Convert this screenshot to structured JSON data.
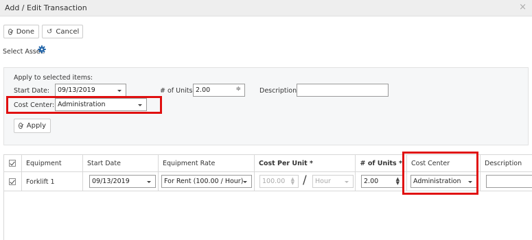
{
  "window": {
    "title": "Add / Edit Transaction",
    "close_glyph": "×"
  },
  "toolbar": {
    "done_label": "Done",
    "cancel_label": "Cancel"
  },
  "select_asset": {
    "label": "Select Asset:",
    "icon": "gear-icon",
    "icon_color": "#1f63a8"
  },
  "apply_panel": {
    "heading": "Apply to selected items:",
    "start_date_label": "Start Date:",
    "start_date_value": "09/13/2019",
    "units_label": "# of Units:",
    "units_value": "2.00",
    "description_label": "Description:",
    "description_value": "",
    "cost_center_label": "Cost Center:",
    "cost_center_value": "Administration",
    "apply_label": "Apply"
  },
  "grid": {
    "columns": [
      "Equipment",
      "Start Date",
      "Equipment Rate",
      "Cost Per Unit *",
      "# of Units *",
      "Cost Center",
      "Description"
    ],
    "rows": [
      {
        "checked": true,
        "equipment": "Forklift 1",
        "start_date": "09/13/2019",
        "equipment_rate": "For Rent (100.00 / Hour)",
        "cost_per_unit": "100.00",
        "cost_unit": "Hour",
        "units": "2.00",
        "cost_center": "Administration",
        "description": ""
      }
    ]
  },
  "highlight_color": "#e01010"
}
